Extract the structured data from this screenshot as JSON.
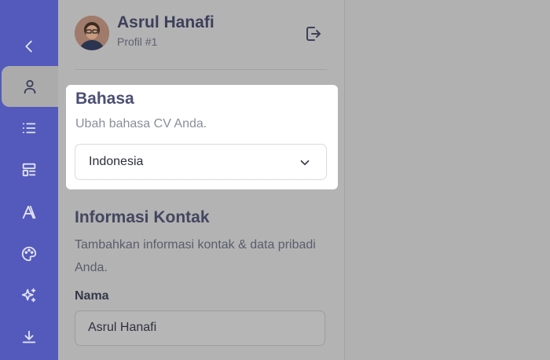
{
  "theme": {
    "rail_color": "#545abb",
    "card_bg": "#ffffff"
  },
  "rail": {
    "items": [
      {
        "icon": "chevron-left-icon"
      },
      {
        "icon": "user-icon",
        "active": true
      },
      {
        "icon": "list-icon"
      },
      {
        "icon": "layout-icon"
      },
      {
        "icon": "font-icon"
      },
      {
        "icon": "palette-icon"
      },
      {
        "icon": "sparkles-icon"
      },
      {
        "icon": "download-icon"
      }
    ]
  },
  "profile": {
    "name": "Asrul Hanafi",
    "subtitle": "Profil #1",
    "logout_icon": "logout-icon"
  },
  "language": {
    "title": "Bahasa",
    "description": "Ubah bahasa CV Anda.",
    "selected": "Indonesia"
  },
  "contact": {
    "title": "Informasi Kontak",
    "description": "Tambahkan informasi kontak & data pribadi Anda.",
    "name_label": "Nama",
    "name_value": "Asrul Hanafi"
  }
}
